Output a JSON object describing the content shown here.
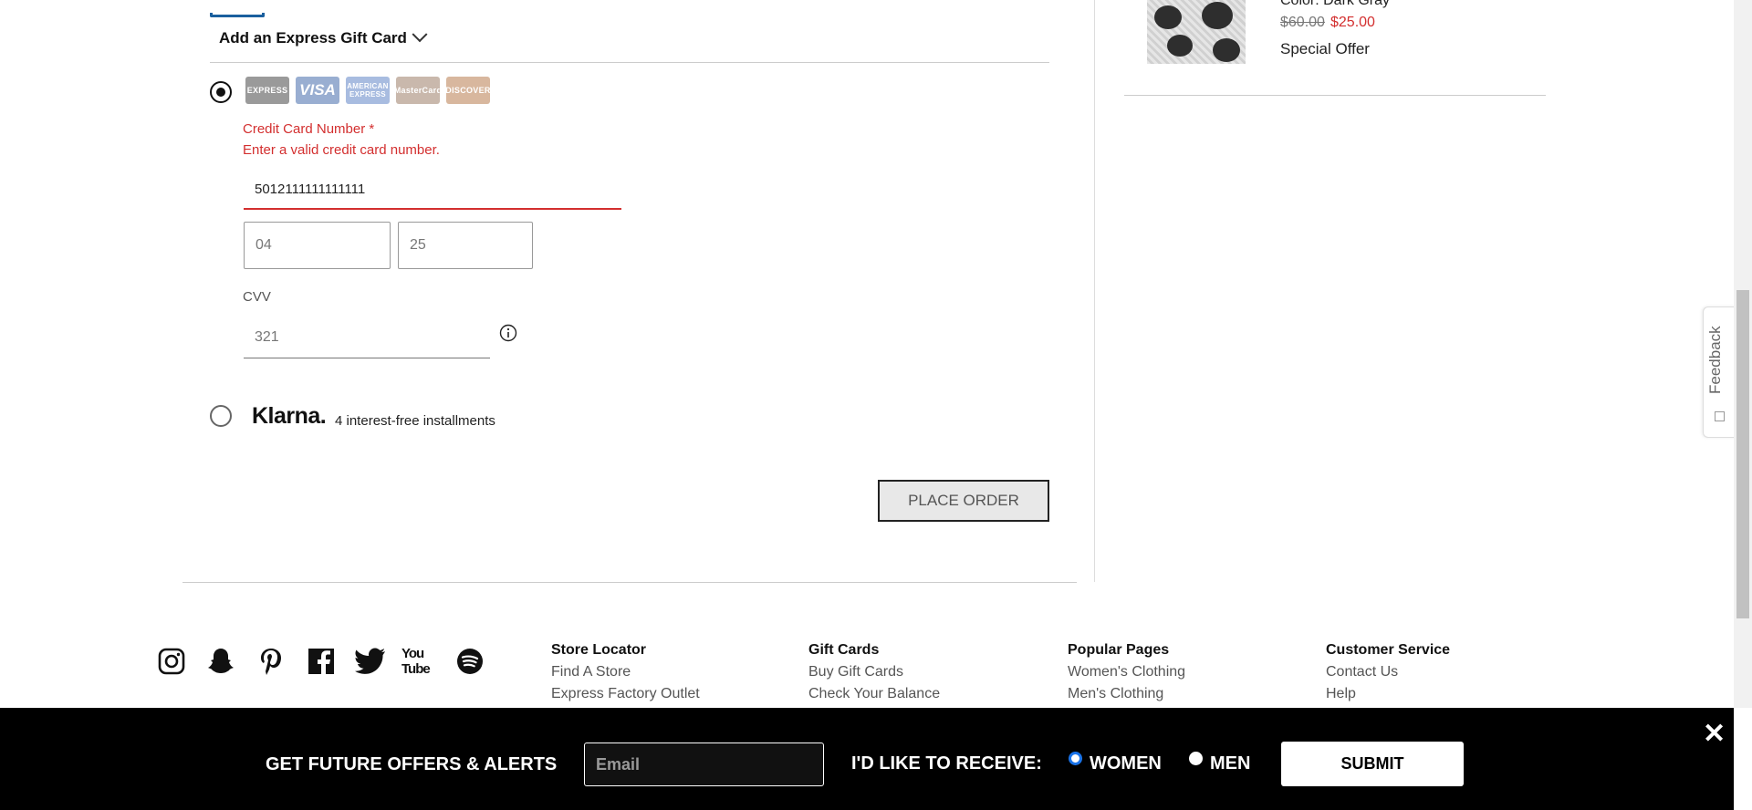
{
  "checkout": {
    "gift_card_toggle": "Add an Express Gift Card",
    "card_brands": [
      "EXPRESS",
      "VISA",
      "AMERICAN EXPRESS",
      "MasterCard",
      "DISCOVER"
    ],
    "cc_label": "Credit Card Number *",
    "cc_error": "Enter a valid credit card number.",
    "cc_value": "5012111111111111",
    "exp_month": "04",
    "exp_year": "25",
    "cvv_label": "CVV",
    "cvv_value": "321",
    "klarna_logo": "Klarna.",
    "klarna_text": "4 interest-free installments",
    "place_order": "PLACE ORDER"
  },
  "order_summary": {
    "color": "Color: Dark Gray",
    "old_price": "$60.00",
    "new_price": "$25.00",
    "offer": "Special Offer"
  },
  "feedback_label": "Feedback",
  "footer": {
    "social_icons": [
      "instagram-icon",
      "snapchat-icon",
      "pinterest-icon",
      "facebook-icon",
      "twitter-icon",
      "youtube-icon",
      "spotify-icon"
    ],
    "youtube_text": "You Tube",
    "columns": [
      {
        "heading": "Store Locator",
        "links": [
          "Find A Store",
          "Express Factory Outlet"
        ]
      },
      {
        "heading": "Gift Cards",
        "links": [
          "Buy Gift Cards",
          "Check Your Balance"
        ]
      },
      {
        "heading": "Popular Pages",
        "links": [
          "Women's Clothing",
          "Men's Clothing"
        ]
      },
      {
        "heading": "Customer Service",
        "links": [
          "Contact Us",
          "Help"
        ]
      }
    ]
  },
  "signup_bar": {
    "title": "GET FUTURE OFFERS & ALERTS",
    "email_placeholder": "Email",
    "receive_label": "I'D LIKE TO RECEIVE:",
    "option_women": "WOMEN",
    "option_men": "MEN",
    "submit": "SUBMIT",
    "close": "✕"
  },
  "colors": {
    "accent": "#1a5f9e",
    "error": "#d32f2f",
    "bar_background": "#000000",
    "radio_selected": "#1a73e8"
  }
}
